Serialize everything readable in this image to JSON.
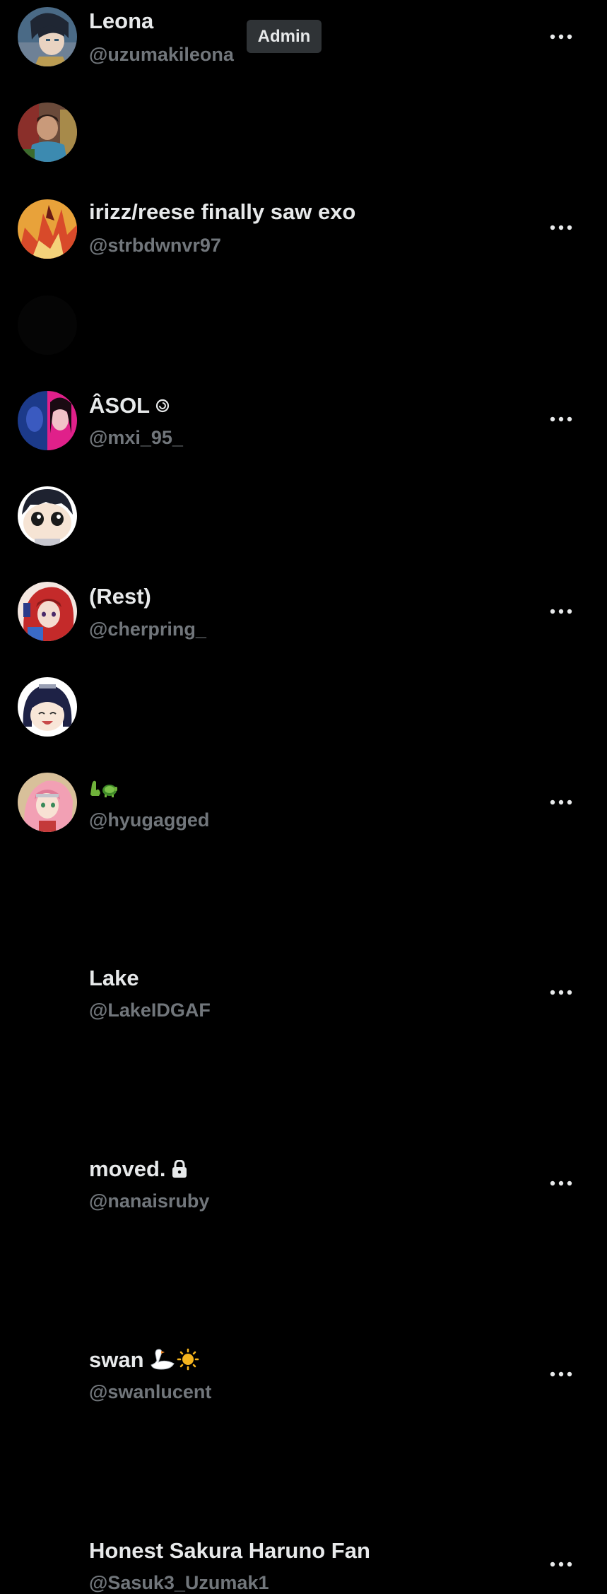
{
  "colors": {
    "background": "#000000",
    "name_text": "#e7e9ea",
    "handle_text": "#71767b",
    "badge_bg": "#2f3336"
  },
  "members": [
    {
      "name": "Leona",
      "handle": "@uzumakileona",
      "badge": "Admin",
      "avatar": "anime-boy-dark-hair",
      "name_icon": ""
    },
    {
      "name": "irizz/reese finally saw exo",
      "handle": "@strbdwnvr97",
      "avatar": "photo-person",
      "name_icon": ""
    },
    {
      "name": "ÂSOL",
      "handle": "@mxi_95_",
      "avatar": "anime-fire-character",
      "name_icon": "swirl-icon"
    },
    {
      "name": "(Rest)",
      "handle": "@cherpring_",
      "avatar": "black-circle",
      "name_icon": ""
    },
    {
      "name": "🦕🐢",
      "handle": "@hyugagged",
      "avatar": "split-blue-pink",
      "name_icon": ""
    },
    {
      "name": "Lake",
      "handle": "@LakeIDGAF",
      "avatar": "chibi-face",
      "name_icon": ""
    },
    {
      "name": "moved.",
      "handle": "@nanaisruby",
      "avatar": "anime-red-hair",
      "name_icon": "lock-icon"
    },
    {
      "name": "swan",
      "handle": "@swanlucent",
      "avatar": "chibi-hinata",
      "name_icon": "swan-sun-emoji"
    },
    {
      "name": "Honest Sakura Haruno Fan",
      "handle": "@Sasuk3_Uzumak1",
      "avatar": "anime-pink-hair",
      "name_icon": ""
    }
  ],
  "more_icon": "more-horizontal-icon"
}
